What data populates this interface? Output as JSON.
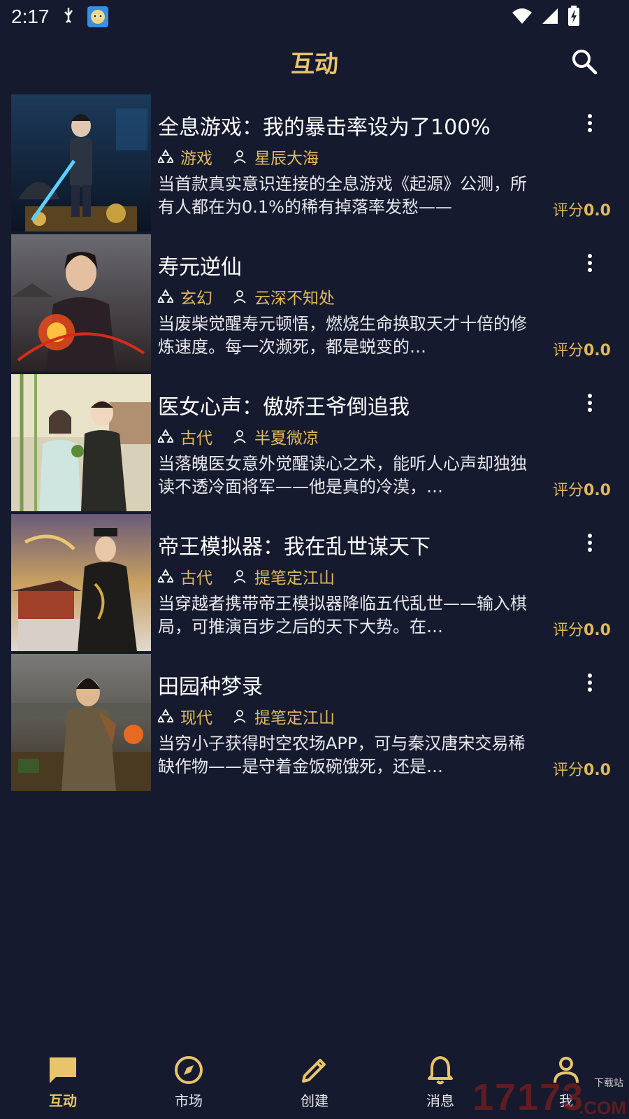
{
  "status_bar": {
    "time": "2:17",
    "icons": [
      "usb-debug-icon",
      "app-badge-icon",
      "wifi-icon",
      "signal-icon",
      "battery-charging-icon"
    ]
  },
  "header": {
    "title": "互动",
    "search_icon": "search-icon"
  },
  "stories": [
    {
      "title": "全息游戏：我的暴击率设为了100%",
      "genre": "游戏",
      "author": "星辰大海",
      "description": "当首款真实意识连接的全息游戏《起源》公测，所有人都在为0.1%的稀有掉落率发愁——",
      "rating_label": "评分",
      "rating_value": "0.0"
    },
    {
      "title": "寿元逆仙",
      "genre": "玄幻",
      "author": "云深不知处",
      "description": "当废柴觉醒寿元顿悟，燃烧生命换取天才十倍的修炼速度。每一次濒死，都是蜕变的…",
      "rating_label": "评分",
      "rating_value": "0.0"
    },
    {
      "title": "医女心声：傲娇王爷倒追我",
      "genre": "古代",
      "author": "半夏微凉",
      "description": "当落魄医女意外觉醒读心之术，能听人心声却独独读不透冷面将军——他是真的冷漠，…",
      "rating_label": "评分",
      "rating_value": "0.0"
    },
    {
      "title": "帝王模拟器：我在乱世谋天下",
      "genre": "古代",
      "author": "提笔定江山",
      "description": "当穿越者携带帝王模拟器降临五代乱世——输入棋局，可推演百步之后的天下大势。在…",
      "rating_label": "评分",
      "rating_value": "0.0"
    },
    {
      "title": "田园种梦录",
      "genre": "现代",
      "author": "提笔定江山",
      "description": "当穷小子获得时空农场APP，可与秦汉唐宋交易稀缺作物——是守着金饭碗饿死，还是…",
      "rating_label": "评分",
      "rating_value": "0.0"
    }
  ],
  "bottom_nav": [
    {
      "label": "互动",
      "icon": "chat-icon",
      "active": true
    },
    {
      "label": "市场",
      "icon": "compass-icon",
      "active": false
    },
    {
      "label": "创建",
      "icon": "pencil-icon",
      "active": false
    },
    {
      "label": "消息",
      "icon": "bell-icon",
      "active": false
    },
    {
      "label": "我",
      "icon": "person-icon",
      "active": false
    }
  ],
  "watermark": {
    "number": "17173",
    "top_text": "下载站",
    "suffix": ".COM"
  },
  "colors": {
    "background": "#151a2e",
    "accent": "#e8c46a",
    "meta": "#e0b95c"
  }
}
